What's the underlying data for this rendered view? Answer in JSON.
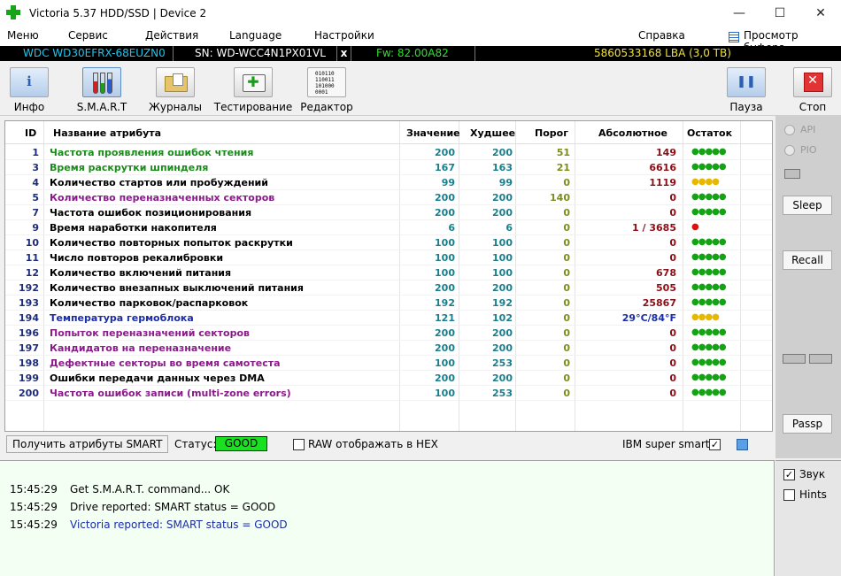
{
  "window": {
    "title": "Victoria 5.37 HDD/SSD | Device 2",
    "controls": {
      "minimize": "—",
      "maximize": "☐",
      "close": "✕"
    }
  },
  "menu": {
    "items": [
      "Меню",
      "Сервис",
      "Действия",
      "Language",
      "Настройки"
    ],
    "help": "Справка",
    "buffer": "Просмотр буфера"
  },
  "device": {
    "model": "WDC WD30EFRX-68EUZN0",
    "serial": "SN: WD-WCC4N1PX01VL",
    "close": "x",
    "firmware": "Fw: 82.00A82",
    "capacity": "5860533168 LBA (3,0 TB)"
  },
  "toolbar": {
    "info": "Инфо",
    "smart": "S.M.A.R.T",
    "logs": "Журналы",
    "test": "Тестирование",
    "editor": "Редактор",
    "pause": "Пауза",
    "stop": "Стоп",
    "editor_icon_text": [
      "010110",
      "110011",
      "101000",
      "0001"
    ]
  },
  "table": {
    "headers": {
      "id": "ID",
      "name": "Название атрибута",
      "value": "Значение",
      "worst": "Худшее",
      "threshold": "Порог",
      "raw": "Абсолютное",
      "remaining": "Остаток"
    },
    "colors": {
      "green": "#1a8c1a",
      "black": "#000000",
      "purple": "#8b1a8b",
      "blue": "#1a2ca8",
      "dot_green": "#14a314",
      "dot_yellow": "#e8b800",
      "dot_red": "#e01010"
    },
    "rows": [
      {
        "id": "1",
        "name": "Частота проявления ошибок чтения",
        "value": "200",
        "worst": "200",
        "threshold": "51",
        "raw": "149",
        "remaining": "●●●●●",
        "name_color": "green",
        "dot_color": "dot_green"
      },
      {
        "id": "3",
        "name": "Время раскрутки шпинделя",
        "value": "167",
        "worst": "163",
        "threshold": "21",
        "raw": "6616",
        "remaining": "●●●●●",
        "name_color": "green",
        "dot_color": "dot_green"
      },
      {
        "id": "4",
        "name": "Количество стартов или пробуждений",
        "value": "99",
        "worst": "99",
        "threshold": "0",
        "raw": "1119",
        "remaining": "●●●●",
        "name_color": "black",
        "dot_color": "dot_yellow"
      },
      {
        "id": "5",
        "name": "Количество переназначенных секторов",
        "value": "200",
        "worst": "200",
        "threshold": "140",
        "raw": "0",
        "remaining": "●●●●●",
        "name_color": "purple",
        "dot_color": "dot_green"
      },
      {
        "id": "7",
        "name": "Частота ошибок позиционирования",
        "value": "200",
        "worst": "200",
        "threshold": "0",
        "raw": "0",
        "remaining": "●●●●●",
        "name_color": "black",
        "dot_color": "dot_green"
      },
      {
        "id": "9",
        "name": "Время наработки накопителя",
        "value": "6",
        "worst": "6",
        "threshold": "0",
        "raw": "1 / 3685",
        "remaining": "●",
        "name_color": "black",
        "dot_color": "dot_red"
      },
      {
        "id": "10",
        "name": "Количество повторных попыток раскрутки",
        "value": "100",
        "worst": "100",
        "threshold": "0",
        "raw": "0",
        "remaining": "●●●●●",
        "name_color": "black",
        "dot_color": "dot_green"
      },
      {
        "id": "11",
        "name": "Число повторов рекалибровки",
        "value": "100",
        "worst": "100",
        "threshold": "0",
        "raw": "0",
        "remaining": "●●●●●",
        "name_color": "black",
        "dot_color": "dot_green"
      },
      {
        "id": "12",
        "name": "Количество включений питания",
        "value": "100",
        "worst": "100",
        "threshold": "0",
        "raw": "678",
        "remaining": "●●●●●",
        "name_color": "black",
        "dot_color": "dot_green"
      },
      {
        "id": "192",
        "name": "Количество внезапных выключений питания",
        "value": "200",
        "worst": "200",
        "threshold": "0",
        "raw": "505",
        "remaining": "●●●●●",
        "name_color": "black",
        "dot_color": "dot_green"
      },
      {
        "id": "193",
        "name": "Количество парковок/распарковок",
        "value": "192",
        "worst": "192",
        "threshold": "0",
        "raw": "25867",
        "remaining": "●●●●●",
        "name_color": "black",
        "dot_color": "dot_green"
      },
      {
        "id": "194",
        "name": "Температура гермоблока",
        "value": "121",
        "worst": "102",
        "threshold": "0",
        "raw": "29°C/84°F",
        "remaining": "●●●●",
        "name_color": "blue",
        "dot_color": "dot_yellow",
        "raw_color": "blue"
      },
      {
        "id": "196",
        "name": "Попыток переназначений секторов",
        "value": "200",
        "worst": "200",
        "threshold": "0",
        "raw": "0",
        "remaining": "●●●●●",
        "name_color": "purple",
        "dot_color": "dot_green"
      },
      {
        "id": "197",
        "name": "Кандидатов на переназначение",
        "value": "200",
        "worst": "200",
        "threshold": "0",
        "raw": "0",
        "remaining": "●●●●●",
        "name_color": "purple",
        "dot_color": "dot_green"
      },
      {
        "id": "198",
        "name": "Дефектные секторы во время самотеста",
        "value": "100",
        "worst": "253",
        "threshold": "0",
        "raw": "0",
        "remaining": "●●●●●",
        "name_color": "purple",
        "dot_color": "dot_green"
      },
      {
        "id": "199",
        "name": "Ошибки передачи данных через DMA",
        "value": "200",
        "worst": "200",
        "threshold": "0",
        "raw": "0",
        "remaining": "●●●●●",
        "name_color": "black",
        "dot_color": "dot_green"
      },
      {
        "id": "200",
        "name": "Частота ошибок записи (multi-zone errors)",
        "value": "100",
        "worst": "253",
        "threshold": "0",
        "raw": "0",
        "remaining": "●●●●●",
        "name_color": "purple",
        "dot_color": "dot_green"
      }
    ]
  },
  "statusbar": {
    "get_button": "Получить атрибуты SMART",
    "status_label": "Статус:",
    "status_value": "GOOD",
    "status_color": "#19e020",
    "raw_hex_label": "RAW отображать в HEX",
    "ibm_label": "IBM super smart:",
    "ibm_checked": "✓"
  },
  "log": {
    "lines": [
      {
        "time": "15:45:29",
        "text": "Get S.M.A.R.T. command... OK",
        "color": "#000000"
      },
      {
        "time": "15:45:29",
        "text": "Drive reported: SMART status = GOOD",
        "color": "#000000"
      },
      {
        "time": "15:45:29",
        "text": "Victoria reported: SMART status = GOOD",
        "color": "#1a2ca8"
      }
    ]
  },
  "rightpanel": {
    "api": "API",
    "pio": "PIO",
    "sleep": "Sleep",
    "recall": "Recall",
    "passp": "Passp",
    "sound": "Звук",
    "sound_checked": "✓",
    "hints": "Hints"
  }
}
